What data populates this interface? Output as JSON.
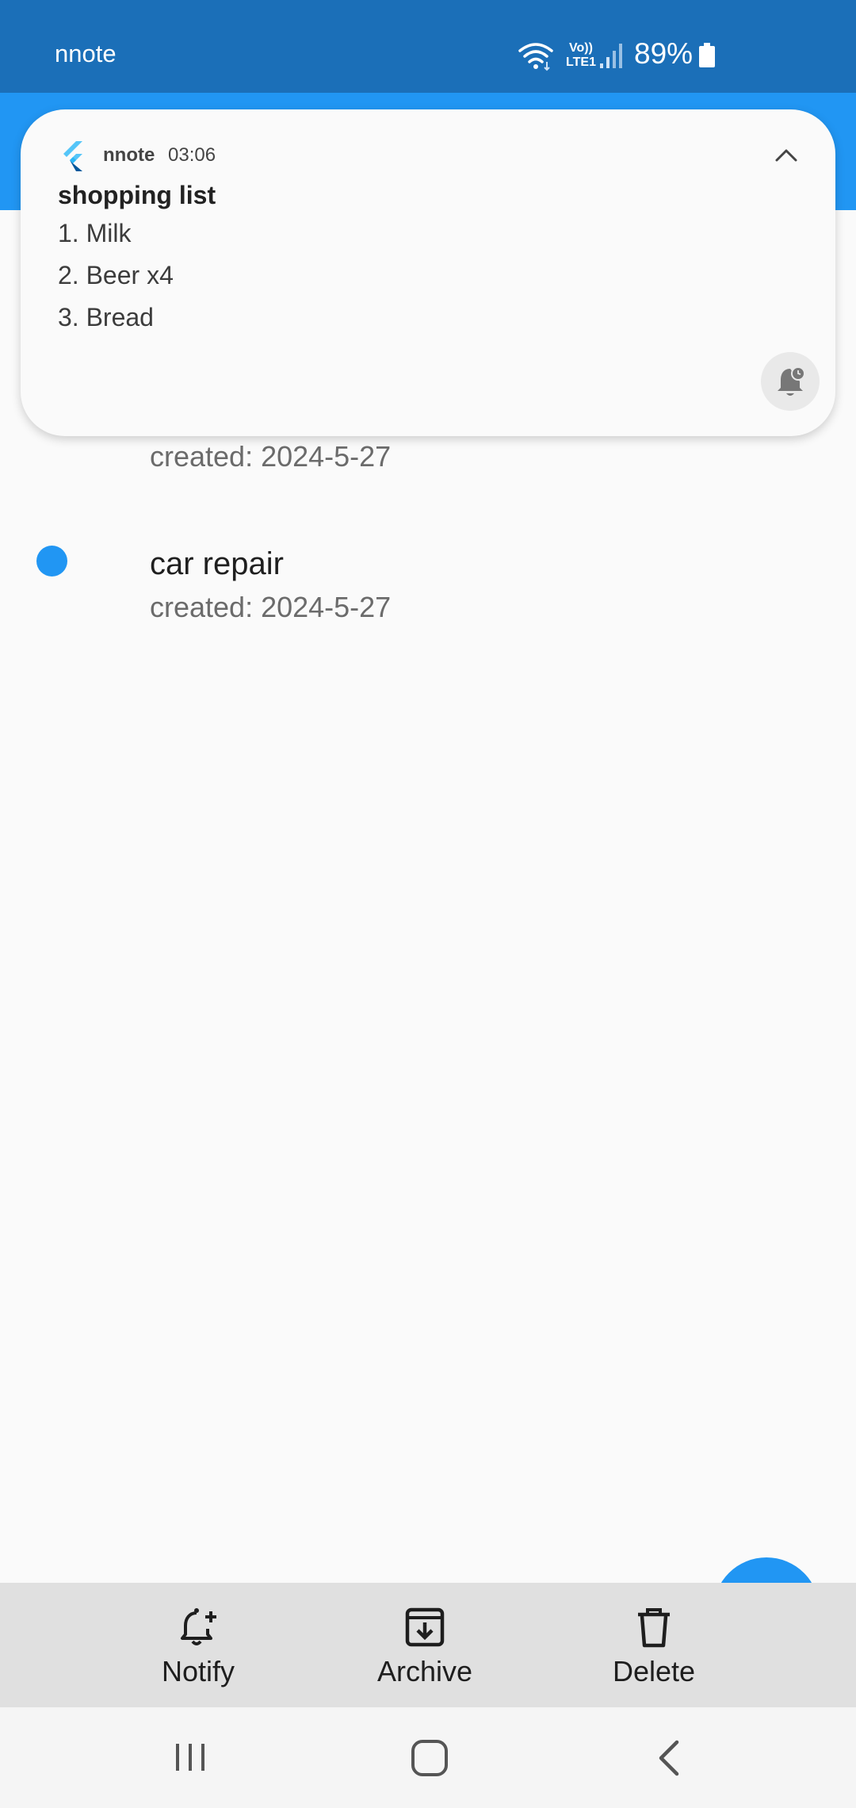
{
  "status_bar": {
    "app_name": "nnote",
    "volte_top": "Vo))",
    "volte_bottom": "LTE1",
    "battery": "89%",
    "icons": [
      "wifi-icon",
      "volte-icon",
      "signal-icon",
      "battery-icon"
    ]
  },
  "notification": {
    "app_name": "nnote",
    "time": "03:06",
    "title": "shopping list",
    "lines": [
      "1. Milk",
      "2. Beer x4",
      "3. Bread"
    ],
    "icons": [
      "flutter-logo-icon",
      "chevron-up-icon",
      "snooze-bell-icon"
    ]
  },
  "notes": [
    {
      "title": "",
      "subtitle": "created: 2024-5-27"
    },
    {
      "title": "car repair",
      "subtitle": "created: 2024-5-27",
      "selected": true
    }
  ],
  "actions": {
    "notify": "Notify",
    "archive": "Archive",
    "delete": "Delete"
  },
  "colors": {
    "status_bar": "#1b6fb8",
    "primary": "#2196f3",
    "background": "#fafafa",
    "action_bar": "#e0e0e0"
  },
  "nav_icons": [
    "recents-icon",
    "home-icon",
    "back-icon"
  ]
}
